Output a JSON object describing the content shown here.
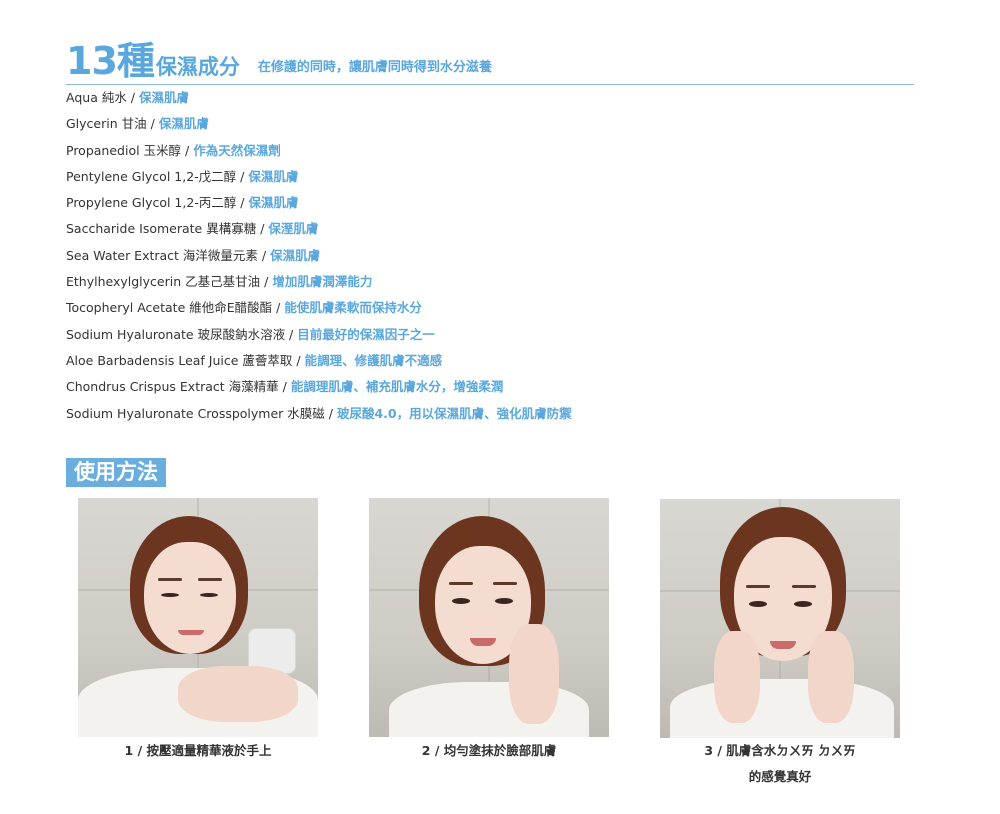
{
  "header": {
    "count": "13種",
    "title": "保濕成分",
    "subtitle": "在修護的同時，讓肌膚同時得到水分滋養"
  },
  "ingredients": [
    {
      "name": "Aqua 純水",
      "desc": "保濕肌膚"
    },
    {
      "name": "Glycerin 甘油",
      "desc": "保濕肌膚"
    },
    {
      "name": "Propanediol 玉米醇",
      "desc": "作為天然保濕劑"
    },
    {
      "name": "Pentylene Glycol 1,2-戊二醇",
      "desc": "保濕肌膚"
    },
    {
      "name": "Propylene Glycol 1,2-丙二醇",
      "desc": "保濕肌膚"
    },
    {
      "name": "Saccharide Isomerate 異構寡糖",
      "desc": "保溼肌膚"
    },
    {
      "name": "Sea Water Extract 海洋微量元素",
      "desc": "保濕肌膚"
    },
    {
      "name": "Ethylhexylglycerin 乙基己基甘油",
      "desc": "增加肌膚潤澤能力"
    },
    {
      "name": "Tocopheryl Acetate 維他命E醋酸酯",
      "desc": "能使肌膚柔軟而保持水分"
    },
    {
      "name": "Sodium Hyaluronate 玻尿酸鈉水溶液",
      "desc": "目前最好的保濕因子之一"
    },
    {
      "name": "Aloe Barbadensis Leaf Juice 蘆薈萃取",
      "desc": "能調理、修護肌膚不適感"
    },
    {
      "name": "Chondrus Crispus Extract 海藻精華",
      "desc": "能調理肌膚、補充肌膚水分，增強柔潤"
    },
    {
      "name": "Sodium Hyaluronate Crosspolymer 水膜磁",
      "desc": "玻尿酸4.0，用以保濕肌膚、強化肌膚防禦"
    }
  ],
  "separator": " / ",
  "usage": {
    "title": "使用方法",
    "steps": [
      {
        "caption": "1 / 按壓適量精華液於手上",
        "caption_line2": ""
      },
      {
        "caption": "2 / 均勻塗抹於臉部肌膚",
        "caption_line2": ""
      },
      {
        "caption": "3 / 肌膚含水ㄉㄨㄞ ㄉㄨㄞ",
        "caption_line2": "的感覺真好"
      }
    ]
  },
  "colors": {
    "accent": "#5aa7dd",
    "text": "#333333",
    "rule": "#8ab9d9"
  }
}
